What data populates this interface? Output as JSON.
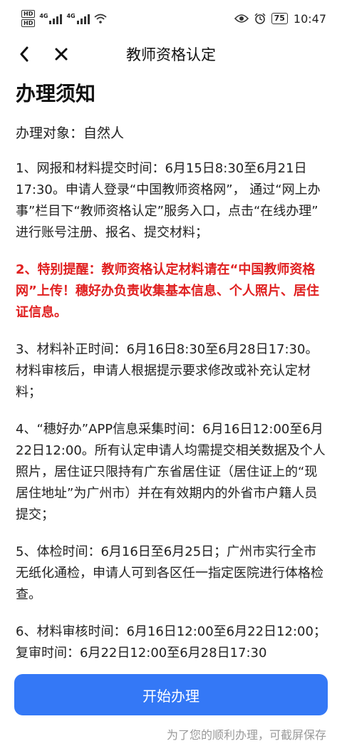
{
  "status_bar": {
    "hd1": "HD",
    "hd2": "HD",
    "net1": "4G",
    "net2": "4G",
    "battery": "75",
    "time": "10:47"
  },
  "nav": {
    "title": "教师资格认定"
  },
  "main": {
    "heading": "办理须知",
    "target": "办理对象：自然人",
    "items": [
      {
        "text": "1、网报和材料提交时间：6月15日8:30至6月21日17:30。申请人登录“中国教师资格网”， 通过“网上办事”栏目下“教师资格认定”服务入口，点击“在线办理” 进行账号注册、报名、提交材料；",
        "red": false
      },
      {
        "text": "2、特别提醒：教师资格认定材料请在“中国教师资格网”上传！穗好办负责收集基本信息、个人照片、居住证信息。",
        "red": true
      },
      {
        "text": "3、材料补正时间：6月16日8:30至6月28日17:30。材料审核后，申请人根据提示要求修改或补充认定材料；",
        "red": false
      },
      {
        "text": "4、“穗好办”APP信息采集时间：6月16日12:00至6月22日12:00。所有认定申请人均需提交相关数据及个人照片，居住证只限持有广东省居住证（居住证上的“现居住地址”为广州市）并在有效期内的外省市户籍人员提交；",
        "red": false
      },
      {
        "text": "5、体检时间：6月16日至6月25日；广州市实行全市无纸化通检，申请人可到各区任一指定医院进行体格检查。",
        "red": false
      },
      {
        "text": "6、材料审核时间：6月16日12:00至6月22日12:00；复审时间：6月22日12:00至6月28日17:30",
        "red": false
      }
    ]
  },
  "action": {
    "button_label": "开始办理"
  },
  "footer": {
    "note": "为了您的顺利办理，可截屏保存"
  },
  "colors": {
    "accent": "#3478f6",
    "warning": "#e02020"
  }
}
